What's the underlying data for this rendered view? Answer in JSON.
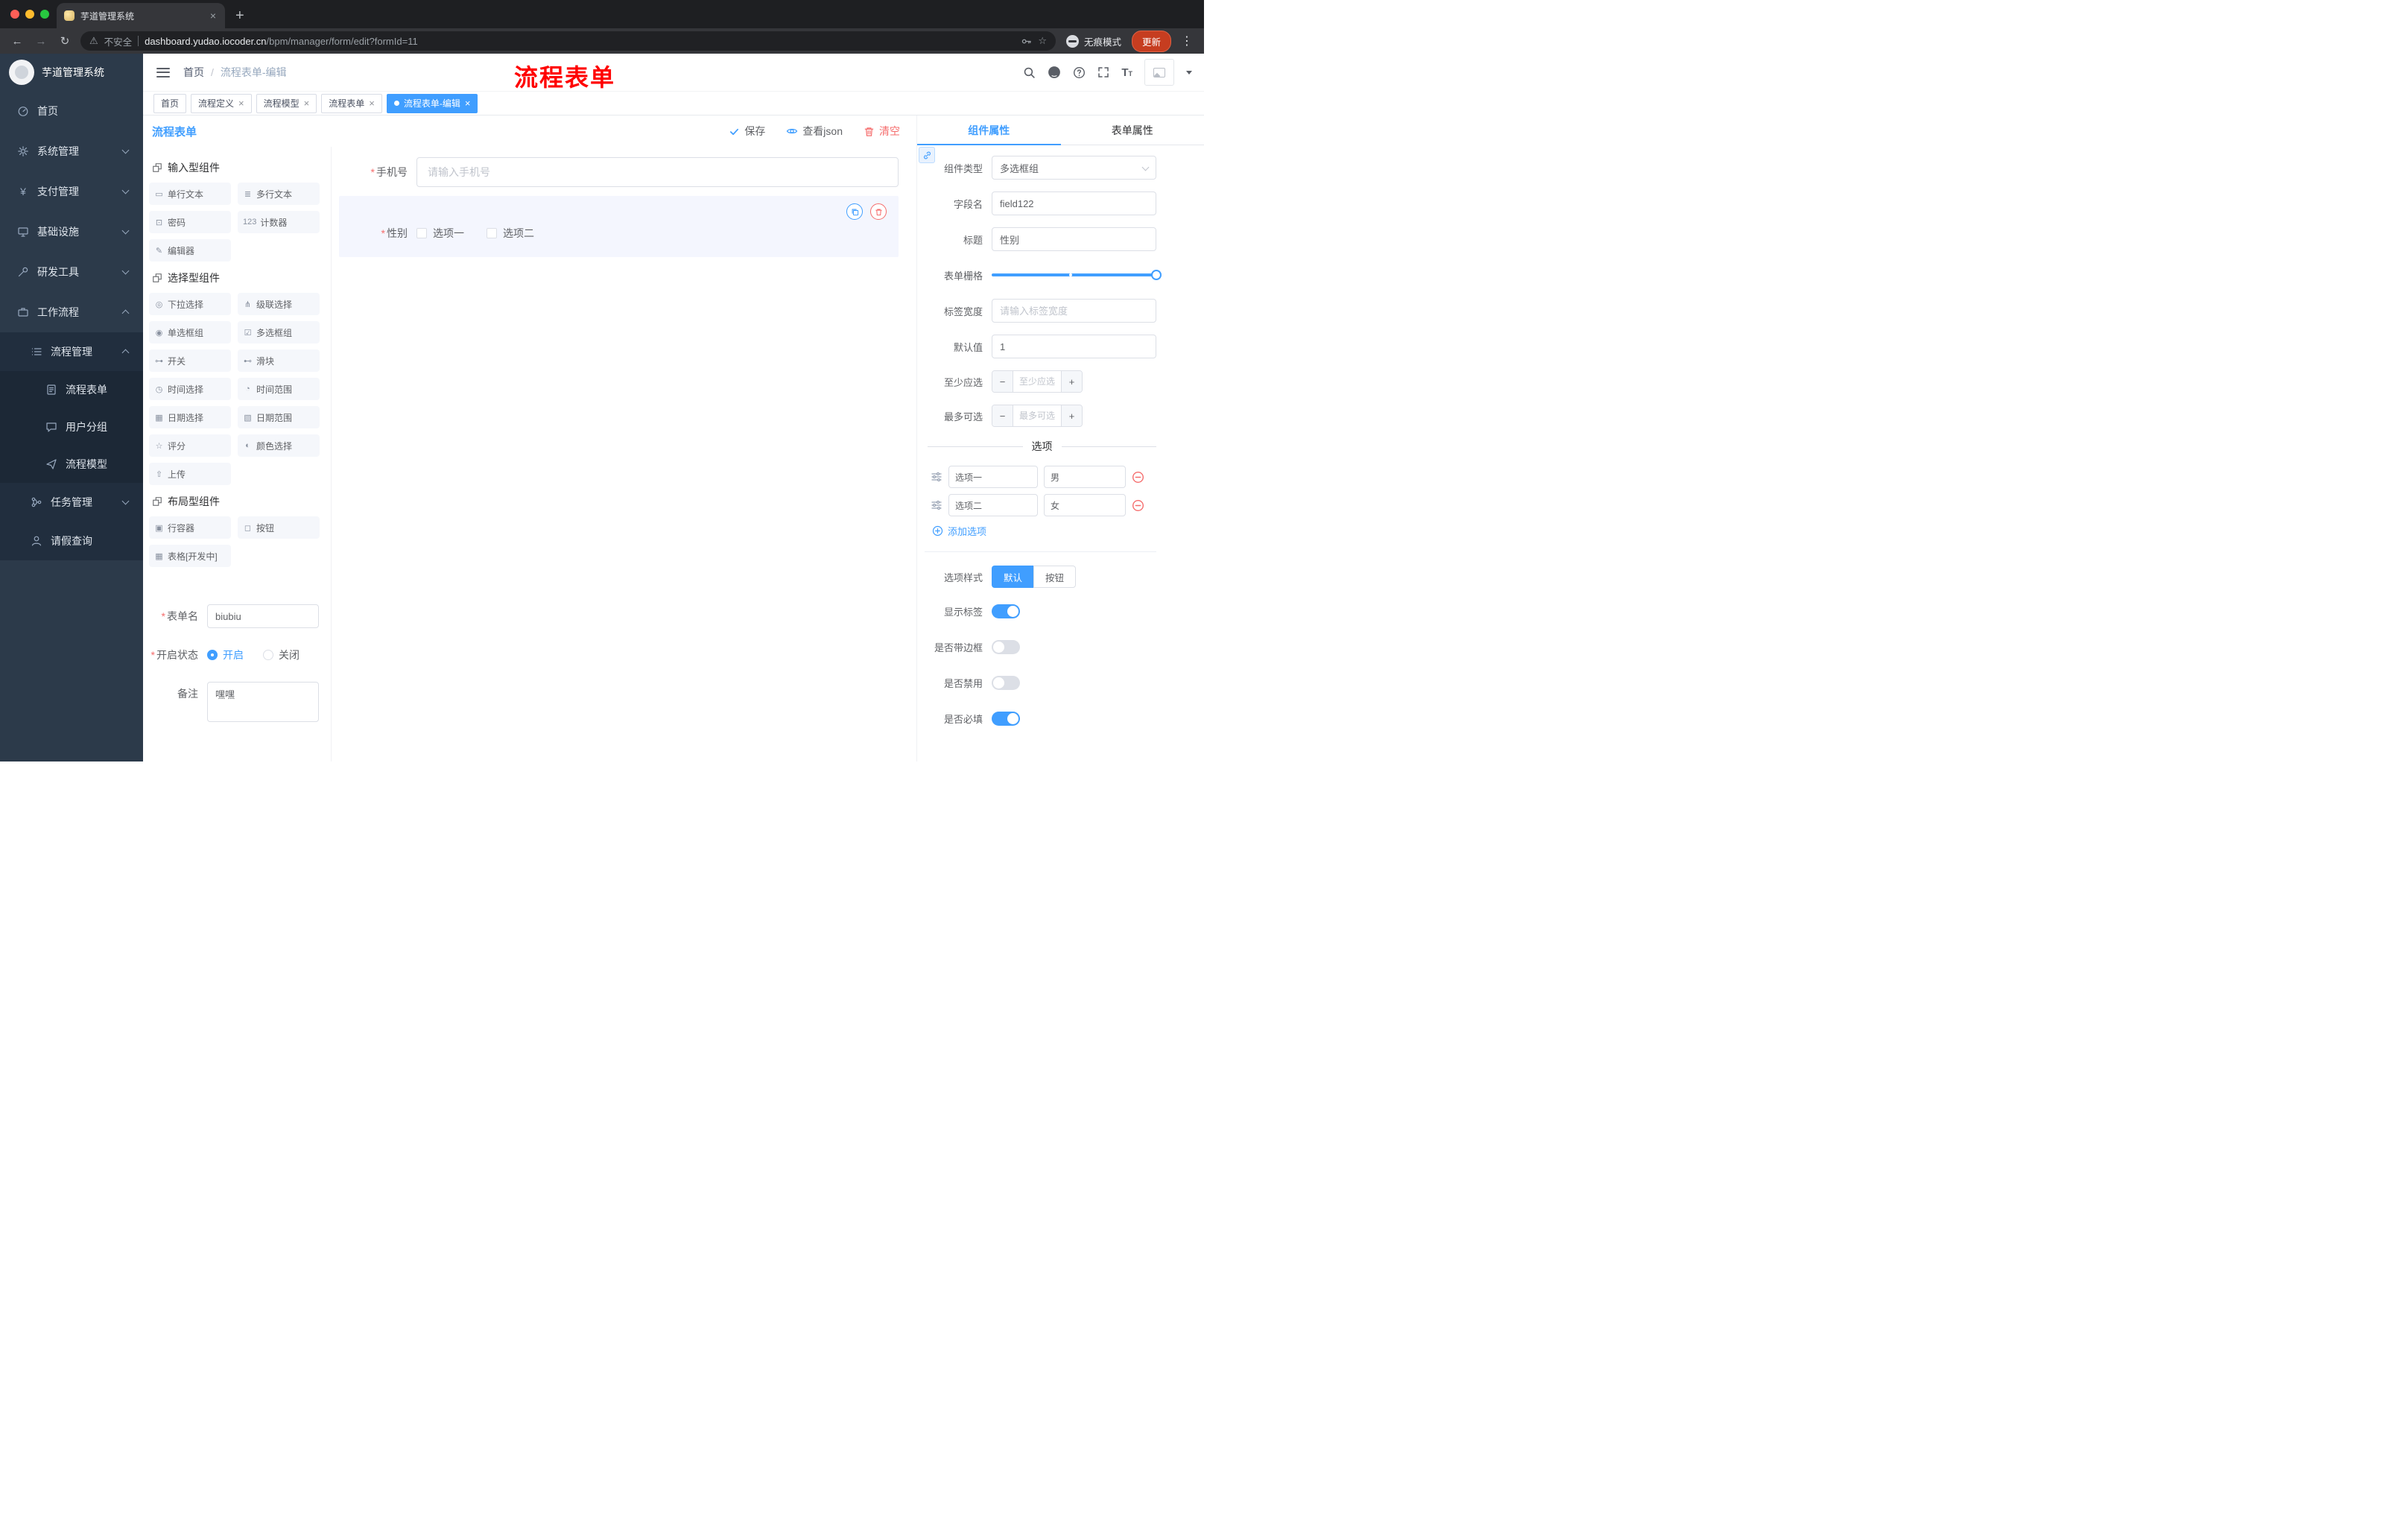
{
  "colors": {
    "accent": "#409eff",
    "danger": "#f56c6c",
    "annotation": "#ff0000",
    "sidebar_bg": "#2c3a4a"
  },
  "glyphs": {
    "back": "←",
    "forward": "→",
    "reload": "↻",
    "warning": "⚠",
    "star": "☆",
    "menu_dots": "⋮",
    "new_tab": "+",
    "close": "×",
    "breadcrumb_sep": "/",
    "asterisk": "*",
    "minus": "−",
    "plus": "+",
    "yen": "¥",
    "font_big": "T",
    "font_small": "T",
    "copy": "⧉"
  },
  "browser": {
    "tab_title": "芋道管理系统",
    "security": "不安全",
    "url_domain": "dashboard.yudao.iocoder.cn",
    "url_path": "/bpm/manager/form/edit?formId=11",
    "incognito": "无痕模式",
    "update": "更新"
  },
  "annotation": "流程表单",
  "sidebar": {
    "app_title": "芋道管理系统",
    "menu": [
      {
        "label": "首页",
        "icon": "dashboard-icon"
      },
      {
        "label": "系统管理",
        "icon": "gear-icon"
      },
      {
        "label": "支付管理",
        "icon": "yen-icon"
      },
      {
        "label": "基础设施",
        "icon": "monitor-icon"
      },
      {
        "label": "研发工具",
        "icon": "tools-icon"
      },
      {
        "label": "工作流程",
        "icon": "briefcase-icon"
      },
      {
        "label": "流程管理",
        "icon": "list-icon"
      },
      {
        "label": "流程表单",
        "icon": "document-icon"
      },
      {
        "label": "用户分组",
        "icon": "chat-icon"
      },
      {
        "label": "流程模型",
        "icon": "send-icon"
      },
      {
        "label": "任务管理",
        "icon": "branch-icon"
      },
      {
        "label": "请假查询",
        "icon": "user-icon"
      }
    ]
  },
  "header": {
    "breadcrumb_home": "首页",
    "breadcrumb_current": "流程表单-编辑"
  },
  "tags": [
    {
      "label": "首页",
      "closable": false,
      "active": false
    },
    {
      "label": "流程定义",
      "closable": true,
      "active": false
    },
    {
      "label": "流程模型",
      "closable": true,
      "active": false
    },
    {
      "label": "流程表单",
      "closable": true,
      "active": false
    },
    {
      "label": "流程表单-编辑",
      "closable": true,
      "active": true
    }
  ],
  "toolbar": {
    "title": "流程表单",
    "save": "保存",
    "view_json": "查看json",
    "clear": "清空"
  },
  "components": {
    "groups": [
      {
        "title": "输入型组件",
        "items": [
          {
            "label": "单行文本",
            "glyph": "▭",
            "icon": "text-field-icon"
          },
          {
            "label": "多行文本",
            "glyph": "≣",
            "icon": "textarea-icon"
          },
          {
            "label": "密码",
            "glyph": "⊡",
            "icon": "password-icon"
          },
          {
            "label": "计数器",
            "glyph": "123",
            "icon": "counter-icon"
          },
          {
            "label": "编辑器",
            "glyph": "✎",
            "icon": "editor-icon"
          }
        ]
      },
      {
        "title": "选择型组件",
        "items": [
          {
            "label": "下拉选择",
            "glyph": "◎",
            "icon": "select-icon"
          },
          {
            "label": "级联选择",
            "glyph": "⋔",
            "icon": "cascader-icon"
          },
          {
            "label": "单选框组",
            "glyph": "◉",
            "icon": "radio-group-icon"
          },
          {
            "label": "多选框组",
            "glyph": "☑",
            "icon": "checkbox-group-icon"
          },
          {
            "label": "开关",
            "glyph": "⊶",
            "icon": "switch-icon"
          },
          {
            "label": "滑块",
            "glyph": "⊷",
            "icon": "slider-icon"
          },
          {
            "label": "时间选择",
            "glyph": "◷",
            "icon": "time-picker-icon"
          },
          {
            "label": "时间范围",
            "glyph": "◔",
            "icon": "time-range-icon"
          },
          {
            "label": "日期选择",
            "glyph": "▦",
            "icon": "date-picker-icon"
          },
          {
            "label": "日期范围",
            "glyph": "▧",
            "icon": "date-range-icon"
          },
          {
            "label": "评分",
            "glyph": "☆",
            "icon": "rate-icon"
          },
          {
            "label": "颜色选择",
            "glyph": "◐",
            "icon": "color-picker-icon"
          },
          {
            "label": "上传",
            "glyph": "⇧",
            "icon": "upload-icon"
          }
        ]
      },
      {
        "title": "布局型组件",
        "items": [
          {
            "label": "行容器",
            "glyph": "▣",
            "icon": "row-container-icon"
          },
          {
            "label": "按钮",
            "glyph": "◻",
            "icon": "button-icon"
          },
          {
            "label": "表格[开发中]",
            "glyph": "▦",
            "icon": "table-icon"
          }
        ]
      }
    ],
    "form": {
      "name_label": "表单名",
      "name_value": "biubiu",
      "status_label": "开启状态",
      "status_on": "开启",
      "status_off": "关闭",
      "remark_label": "备注",
      "remark_value": "嘿嘿"
    }
  },
  "canvas": {
    "phone_label": "手机号",
    "phone_placeholder": "请输入手机号",
    "gender_label": "性别",
    "gender_options": [
      {
        "label": "选项一"
      },
      {
        "label": "选项二"
      }
    ]
  },
  "props": {
    "tabs": [
      {
        "label": "组件属性"
      },
      {
        "label": "表单属性"
      }
    ],
    "rows": {
      "component_type": {
        "label": "组件类型",
        "value": "多选框组"
      },
      "field_name": {
        "label": "字段名",
        "value": "field122"
      },
      "title": {
        "label": "标题",
        "value": "性别"
      },
      "grid": {
        "label": "表单栅格"
      },
      "label_width": {
        "label": "标签宽度",
        "placeholder": "请输入标签宽度"
      },
      "default": {
        "label": "默认值",
        "value": "1"
      },
      "min": {
        "label": "至少应选",
        "placeholder": "至少应选"
      },
      "max": {
        "label": "最多可选",
        "placeholder": "最多可选"
      }
    },
    "options": {
      "title": "选项",
      "rows": [
        {
          "name": "选项一",
          "value": "男"
        },
        {
          "name": "选项二",
          "value": "女"
        }
      ],
      "add": "添加选项"
    },
    "style": {
      "label": "选项样式",
      "default": "默认",
      "button": "按钮"
    },
    "toggles": [
      {
        "label": "显示标签",
        "on": true
      },
      {
        "label": "是否带边框",
        "on": false
      },
      {
        "label": "是否禁用",
        "on": false
      },
      {
        "label": "是否必填",
        "on": true
      }
    ]
  }
}
